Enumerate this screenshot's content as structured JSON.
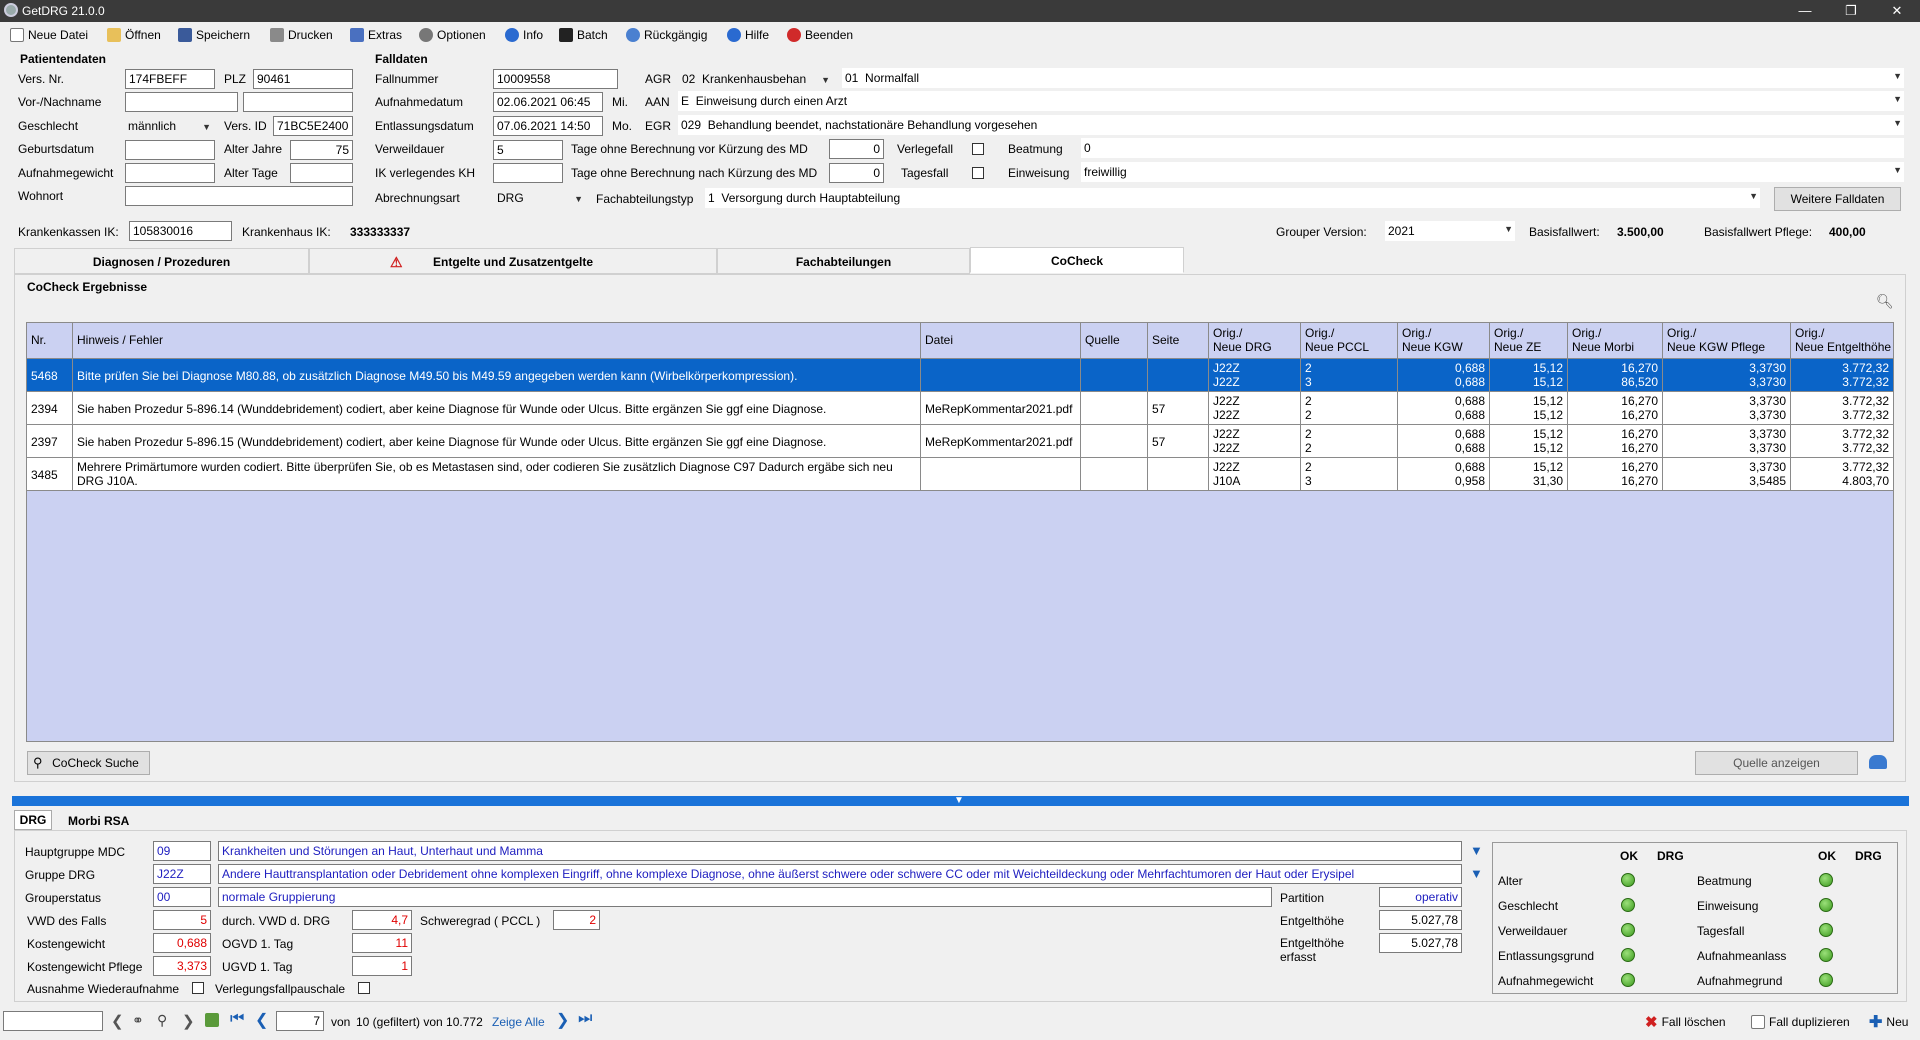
{
  "window": {
    "title": "GetDRG 21.0.0"
  },
  "toolbar": [
    {
      "label": "Neue Datei",
      "icon": "new-file-icon"
    },
    {
      "label": "Öffnen",
      "icon": "folder-open-icon"
    },
    {
      "label": "Speichern",
      "icon": "save-icon"
    },
    {
      "label": "Drucken",
      "icon": "print-icon"
    },
    {
      "label": "Extras",
      "icon": "tools-icon"
    },
    {
      "label": "Optionen",
      "icon": "options-icon"
    },
    {
      "label": "Info",
      "icon": "info-icon"
    },
    {
      "label": "Batch",
      "icon": "console-icon"
    },
    {
      "label": "Rückgängig",
      "icon": "undo-icon"
    },
    {
      "label": "Hilfe",
      "icon": "help-icon"
    },
    {
      "label": "Beenden",
      "icon": "exit-icon"
    }
  ],
  "patient": {
    "section": "Patientendaten",
    "vers_nr_label": "Vers. Nr.",
    "vers_nr": "174FBEFF",
    "plz_label": "PLZ",
    "plz": "90461",
    "name_label": "Vor-/Nachname",
    "vorname": "",
    "nachname": "",
    "geschlecht_label": "Geschlecht",
    "geschlecht": "männlich",
    "vers_id_label": "Vers. ID",
    "vers_id": "71BC5E2400",
    "geburtsdatum_label": "Geburtsdatum",
    "geburtsdatum": "",
    "alter_jahre_label": "Alter Jahre",
    "alter_jahre": "75",
    "aufnahmegewicht_label": "Aufnahmegewicht",
    "aufnahmegewicht": "",
    "alter_tage_label": "Alter Tage",
    "alter_tage": "",
    "wohnort_label": "Wohnort",
    "wohnort": ""
  },
  "fall": {
    "section": "Falldaten",
    "fallnummer_label": "Fallnummer",
    "fallnummer": "10009558",
    "aufnahmedatum_label": "Aufnahmedatum",
    "aufnahmedatum": "02.06.2021 06:45",
    "aufnahme_tag": "Mi.",
    "entlassungsdatum_label": "Entlassungsdatum",
    "entlassungsdatum": "07.06.2021 14:50",
    "entlassung_tag": "Mo.",
    "verweildauer_label": "Verweildauer",
    "verweildauer": "5",
    "ik_label": "IK verlegendes KH",
    "ik": "",
    "abrechnungsart_label": "Abrechnungsart",
    "abrechnungsart": "DRG",
    "agr_label": "AGR",
    "agr_code": "02",
    "agr_text": "Krankenhausbehan",
    "agr2_code": "01",
    "agr2_text": "Normalfall",
    "aan_label": "AAN",
    "aan_code": "E",
    "aan_text": "Einweisung durch einen Arzt",
    "egr_label": "EGR",
    "egr_code": "029",
    "egr_text": "Behandlung beendet, nachstationäre Behandlung vorgesehen",
    "tage_vor_label": "Tage ohne Berechnung vor Kürzung des MD",
    "tage_vor": "0",
    "tage_nach_label": "Tage ohne Berechnung nach Kürzung des MD",
    "tage_nach": "0",
    "verlegefall_label": "Verlegefall",
    "tagesfall_label": "Tagesfall",
    "beatmung_label": "Beatmung",
    "beatmung": "0",
    "einweisung_label": "Einweisung",
    "einweisung": "freiwillig",
    "fachabteilungstyp_label": "Fachabteilungstyp",
    "fachabteilungstyp_code": "1",
    "fachabteilungstyp_text": "Versorgung durch Hauptabteilung",
    "weitere_button": "Weitere Falldaten"
  },
  "kasse": {
    "kk_ik_label": "Krankenkassen IK:",
    "kk_ik": "105830016",
    "kh_ik_label": "Krankenhaus IK:",
    "kh_ik": "333333337",
    "grouper_label": "Grouper Version:",
    "grouper": "2021",
    "basisfallwert_label": "Basisfallwert:",
    "basisfallwert": "3.500,00",
    "basisfallwert_pflege_label": "Basisfallwert Pflege:",
    "basisfallwert_pflege": "400,00"
  },
  "tabs": [
    "Diagnosen / Prozeduren",
    "Entgelte und Zusatzentgelte",
    "Fachabteilungen",
    "CoCheck"
  ],
  "cocheck": {
    "title": "CoCheck Ergebnisse",
    "columns": [
      "Nr.",
      "Hinweis / Fehler",
      "Datei",
      "Quelle",
      "Seite",
      "Orig./\nNeue DRG",
      "Orig./\nNeue PCCL",
      "Orig./\nNeue KGW",
      "Orig./\nNeue ZE",
      "Orig./\nNeue Morbi",
      "Orig./\nNeue KGW Pflege",
      "Orig./\nNeue Entgelthöhe"
    ],
    "rows": [
      {
        "nr": "5468",
        "hinweis": "Bitte prüfen Sie bei Diagnose M80.88, ob zusätzlich Diagnose M49.50 bis M49.59 angegeben werden kann (Wirbelkörperkompression).",
        "datei": "",
        "quelle": "",
        "seite": "",
        "drg": [
          "J22Z",
          "J22Z"
        ],
        "pccl": [
          "2",
          "3"
        ],
        "kgw": [
          "0,688",
          "0,688"
        ],
        "ze": [
          "15,12",
          "15,12"
        ],
        "morbi": [
          "16,270",
          "86,520"
        ],
        "kgwp": [
          "3,3730",
          "3,3730"
        ],
        "entgelt": [
          "3.772,32",
          "3.772,32"
        ]
      },
      {
        "nr": "2394",
        "hinweis": "Sie haben Prozedur 5-896.14 (Wunddebridement) codiert, aber keine Diagnose für Wunde oder Ulcus. Bitte ergänzen Sie ggf eine Diagnose.",
        "datei": "MeRepKommentar2021.pdf",
        "quelle": "",
        "seite": "57",
        "drg": [
          "J22Z",
          "J22Z"
        ],
        "pccl": [
          "2",
          "2"
        ],
        "kgw": [
          "0,688",
          "0,688"
        ],
        "ze": [
          "15,12",
          "15,12"
        ],
        "morbi": [
          "16,270",
          "16,270"
        ],
        "kgwp": [
          "3,3730",
          "3,3730"
        ],
        "entgelt": [
          "3.772,32",
          "3.772,32"
        ]
      },
      {
        "nr": "2397",
        "hinweis": "Sie haben Prozedur 5-896.15 (Wunddebridement) codiert, aber keine Diagnose für Wunde oder Ulcus. Bitte ergänzen Sie ggf eine Diagnose.",
        "datei": "MeRepKommentar2021.pdf",
        "quelle": "",
        "seite": "57",
        "drg": [
          "J22Z",
          "J22Z"
        ],
        "pccl": [
          "2",
          "2"
        ],
        "kgw": [
          "0,688",
          "0,688"
        ],
        "ze": [
          "15,12",
          "15,12"
        ],
        "morbi": [
          "16,270",
          "16,270"
        ],
        "kgwp": [
          "3,3730",
          "3,3730"
        ],
        "entgelt": [
          "3.772,32",
          "3.772,32"
        ]
      },
      {
        "nr": "3485",
        "hinweis": "Mehrere Primärtumore wurden codiert. Bitte überprüfen Sie, ob es Metastasen sind, oder codieren Sie zusätzlich Diagnose C97 Dadurch ergäbe sich neu DRG J10A.",
        "datei": "",
        "quelle": "",
        "seite": "",
        "drg": [
          "J22Z",
          "J10A"
        ],
        "pccl": [
          "2",
          "3"
        ],
        "kgw": [
          "0,688",
          "0,958"
        ],
        "ze": [
          "15,12",
          "31,30"
        ],
        "morbi": [
          "16,270",
          "16,270"
        ],
        "kgwp": [
          "3,3730",
          "3,5485"
        ],
        "entgelt": [
          "3.772,32",
          "4.803,70"
        ]
      }
    ],
    "suche_button": "CoCheck Suche",
    "quelle_button": "Quelle anzeigen"
  },
  "bottom_tabs": [
    "DRG",
    "Morbi RSA"
  ],
  "drg": {
    "mdc_label": "Hauptgruppe MDC",
    "mdc_code": "09",
    "mdc_text": "Krankheiten und Störungen an Haut, Unterhaut und Mamma",
    "gruppe_label": "Gruppe DRG",
    "gruppe_code": "J22Z",
    "gruppe_text": "Andere Hauttransplantation oder Debridement ohne komplexen Eingriff, ohne komplexe Diagnose, ohne äußerst schwere oder schwere CC oder mit Weichteildeckung oder Mehrfachtumoren der Haut oder Erysipel",
    "grouperstatus_label": "Grouperstatus",
    "grouperstatus_code": "00",
    "grouperstatus_text": "normale Gruppierung",
    "vwd_label": "VWD des Falls",
    "vwd": "5",
    "durch_vwd_label": "durch. VWD d. DRG",
    "durch_vwd": "4,7",
    "schweregrad_label": "Schweregrad ( PCCL )",
    "schweregrad": "2",
    "kostengewicht_label": "Kostengewicht",
    "kostengewicht": "0,688",
    "ogvd_label": "OGVD 1. Tag",
    "ogvd": "11",
    "kgw_pflege_label": "Kostengewicht Pflege",
    "kgw_pflege": "3,373",
    "ugvd_label": "UGVD 1. Tag",
    "ugvd": "1",
    "ausnahme_label": "Ausnahme Wiederaufnahme",
    "verlegung_label": "Verlegungsfallpauschale",
    "partition_label": "Partition",
    "partition": "operativ",
    "entgelthoehe_label": "Entgelthöhe",
    "entgelthoehe": "5.027,78",
    "entgelthoehe_erfasst_label": "Entgelthöhe erfasst",
    "entgelthoehe_erfasst": "5.027,78"
  },
  "checks": {
    "ok_header": "OK",
    "drg_header": "DRG",
    "left": [
      "Alter",
      "Geschlecht",
      "Verweildauer",
      "Entlassungsgrund",
      "Aufnahmegewicht"
    ],
    "right": [
      "Beatmung",
      "Einweisung",
      "Tagesfall",
      "Aufnahmeanlass",
      "Aufnahmegrund"
    ]
  },
  "nav": {
    "search": "",
    "page": "7",
    "von_text": "von",
    "count_text": "10 (gefiltert) von 10.772",
    "show_all": "Zeige Alle",
    "delete": "Fall löschen",
    "duplicate": "Fall duplizieren",
    "new": "Neu"
  },
  "colors": {
    "selection": "#0a64c8",
    "grid_bg": "#cbd1f2",
    "separator": "#1a73d9",
    "link": "#2020c0",
    "value_red": "#e00000"
  }
}
